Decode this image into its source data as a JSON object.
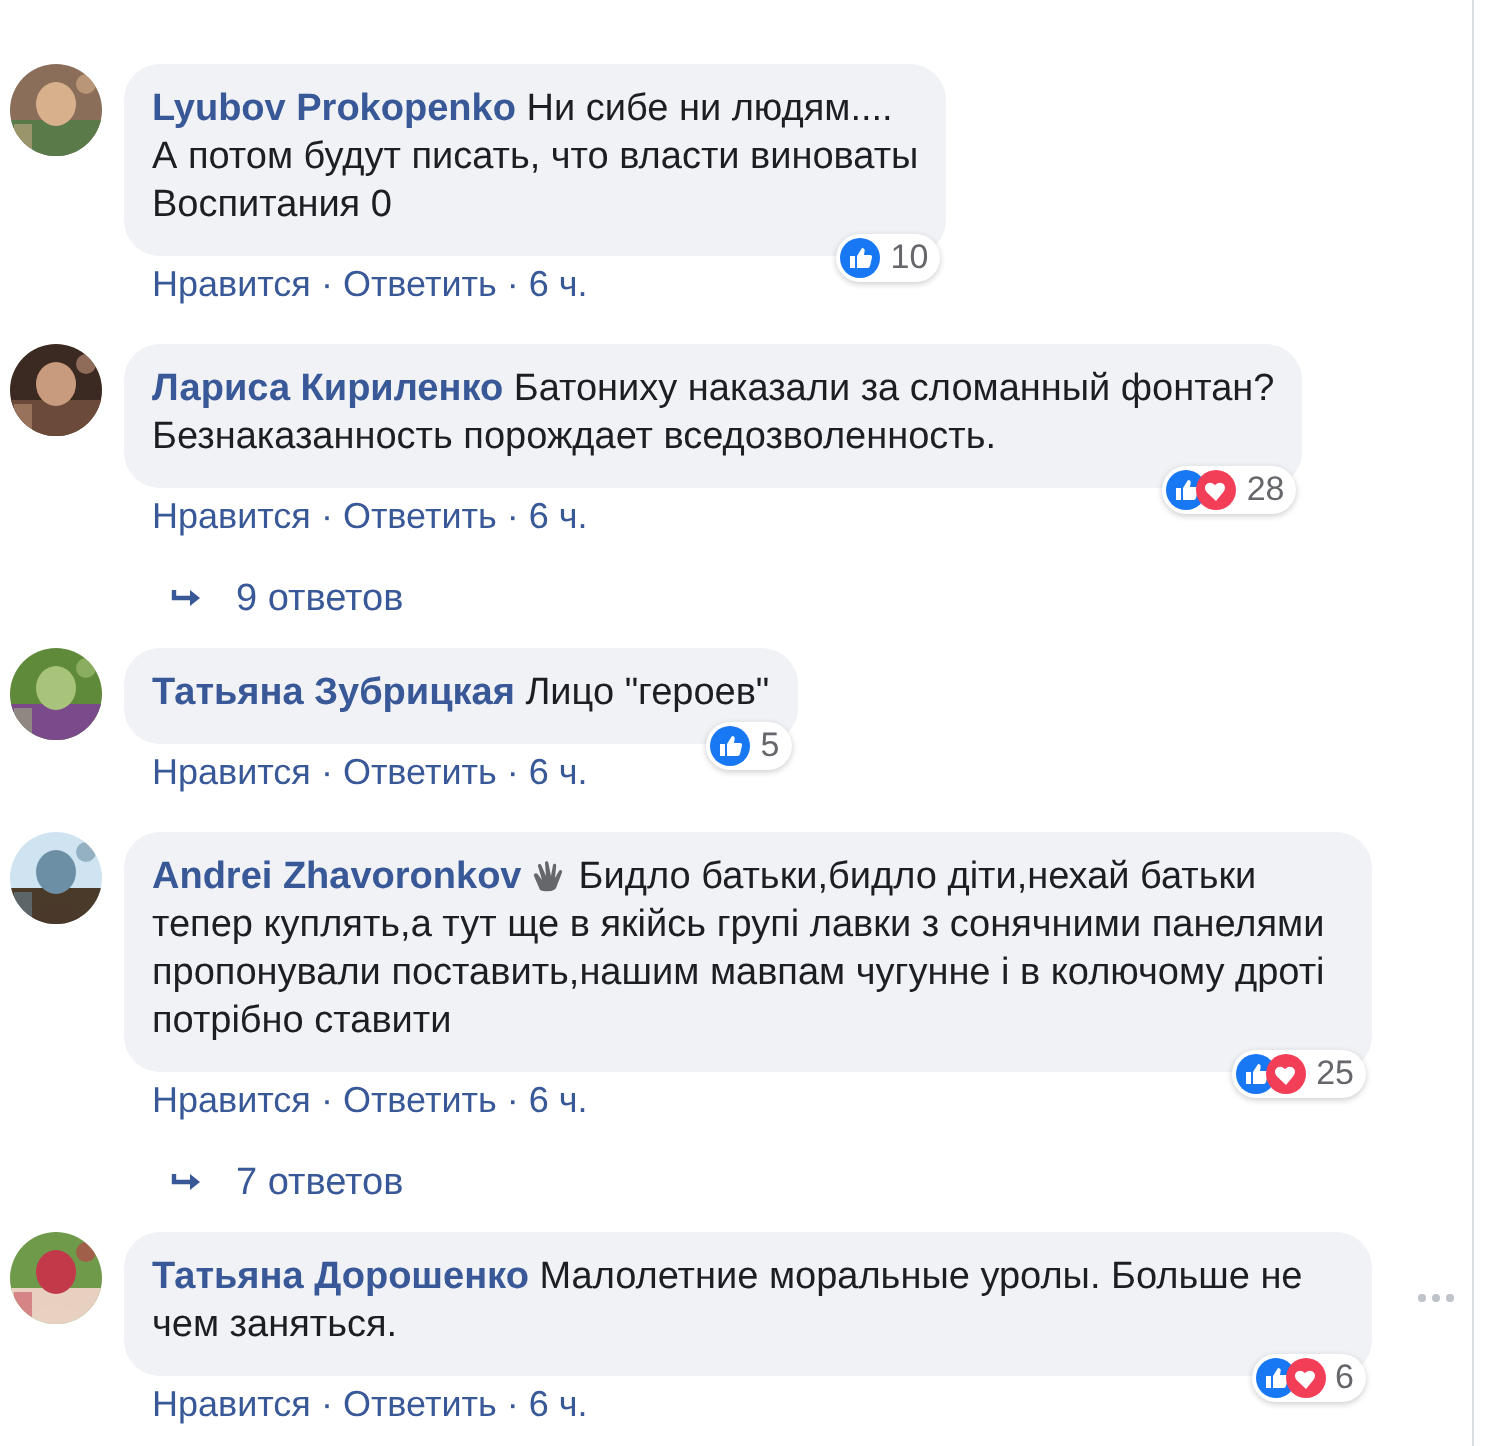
{
  "items": [
    {
      "kind": "comment",
      "author": "Lyubov Prokopenko",
      "has_badge": false,
      "text": "Ни сибе ни людям....\nА потом будут писать, что власти виноваты\nВоспитания 0",
      "reactions": [
        {
          "kind": "like"
        }
      ],
      "reaction_count": "10",
      "actions": [
        "Нравится",
        "·",
        "Ответить",
        "·",
        "6 ч."
      ],
      "more_menu": false
    },
    {
      "kind": "comment",
      "author": "Лариса Кириленко",
      "has_badge": false,
      "text": "Батониху наказали за сломанный фонтан?\nБезнаказанность порождает вседозволенность.",
      "reactions": [
        {
          "kind": "like"
        },
        {
          "kind": "love"
        }
      ],
      "reaction_count": "28",
      "actions": [
        "Нравится",
        "·",
        "Ответить",
        "·",
        "6 ч."
      ],
      "more_menu": false
    },
    {
      "kind": "replies",
      "label": "9 ответов"
    },
    {
      "kind": "comment",
      "author": "Татьяна Зубрицкая",
      "has_badge": false,
      "text": "Лицо \"героев\"",
      "reactions": [
        {
          "kind": "like"
        }
      ],
      "reaction_count": "5",
      "actions": [
        "Нравится",
        "·",
        "Ответить",
        "·",
        "6 ч."
      ],
      "more_menu": false
    },
    {
      "kind": "comment",
      "author": "Andrei Zhavoronkov",
      "has_badge": true,
      "text": "Бидло батьки,бидло діти,нехай батьки тепер куплять,а тут ще в якійсь групі лавки з сонячними панелями пропонували поставить,нашим мавпам чугунне і в колючому дроті потрібно ставити",
      "reactions": [
        {
          "kind": "like"
        },
        {
          "kind": "love"
        }
      ],
      "reaction_count": "25",
      "actions": [
        "Нравится",
        "·",
        "Ответить",
        "·",
        "6 ч."
      ],
      "more_menu": false
    },
    {
      "kind": "replies",
      "label": "7 ответов"
    },
    {
      "kind": "comment",
      "author": "Татьяна Дорошенко",
      "has_badge": false,
      "text": "Малолетние моральные уролы. Больше не чем заняться.",
      "reactions": [
        {
          "kind": "like"
        },
        {
          "kind": "love"
        }
      ],
      "reaction_count": "6",
      "actions": [
        "Нравится",
        "·",
        "Ответить",
        "·",
        "6 ч."
      ],
      "more_menu": true
    }
  ]
}
